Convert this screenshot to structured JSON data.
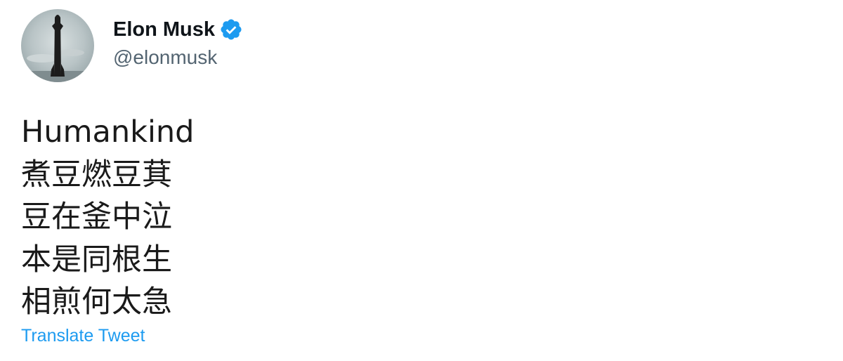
{
  "author": {
    "display_name": "Elon Musk",
    "handle": "@elonmusk",
    "verified": true,
    "avatar_icon": "starship-rocket-avatar"
  },
  "tweet": {
    "lines": [
      "Humankind",
      "煮豆燃豆萁",
      "豆在釜中泣",
      "本是同根生",
      "相煎何太急"
    ]
  },
  "actions": {
    "translate_label": "Translate Tweet"
  },
  "colors": {
    "verified_badge": "#1d9bf0",
    "link": "#1d9bf0",
    "name": "#0f1419",
    "handle": "#536471"
  }
}
